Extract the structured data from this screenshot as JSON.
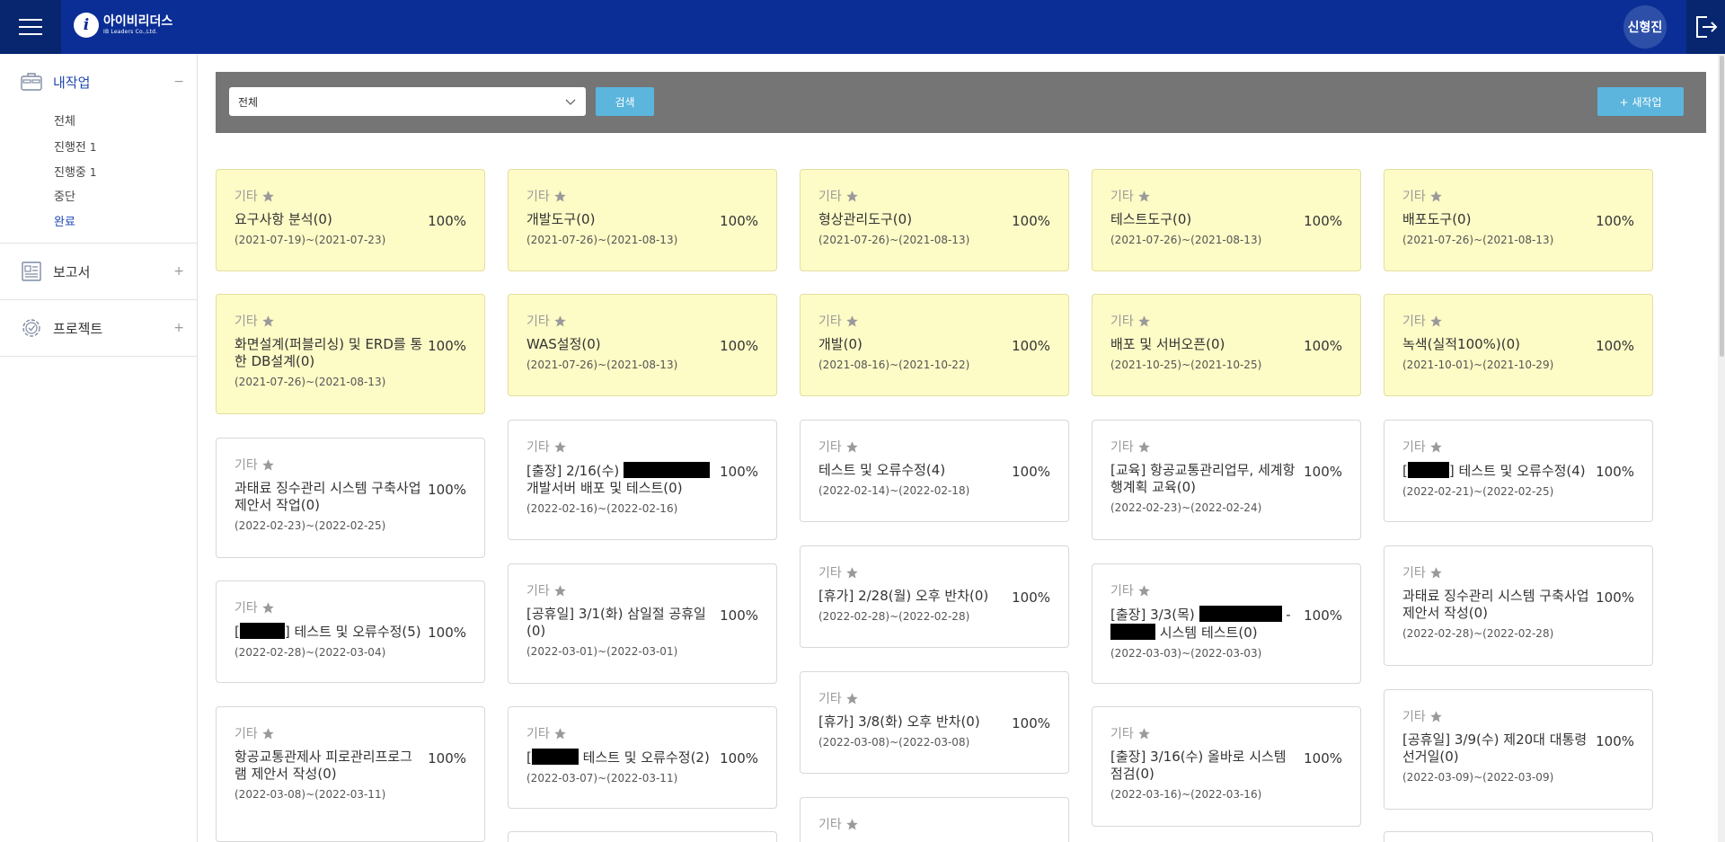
{
  "header": {
    "logo_kr": "아이비리더스",
    "logo_en": "IB Leaders Co.,Ltd.",
    "user_name": "신형진"
  },
  "sidebar": {
    "work_label": "내작업",
    "work_toggle": "−",
    "sub_items": [
      {
        "label": "전체",
        "count": ""
      },
      {
        "label": "진행전",
        "count": "1"
      },
      {
        "label": "진행중",
        "count": "1"
      },
      {
        "label": "중단",
        "count": ""
      },
      {
        "label": "완료",
        "count": ""
      }
    ],
    "report_label": "보고서",
    "report_toggle": "+",
    "project_label": "프로젝트",
    "project_toggle": "+"
  },
  "filter": {
    "select_value": "전체",
    "search_label": "검색",
    "new_label": "+ 새작업"
  },
  "cards": [
    {
      "category": "기타",
      "title": "요구사항 분석(0)",
      "percent": "100%",
      "dates": "(2021-07-19)~(2021-07-23)"
    },
    {
      "category": "기타",
      "title": "개발도구(0)",
      "percent": "100%",
      "dates": "(2021-07-26)~(2021-08-13)"
    },
    {
      "category": "기타",
      "title": "형상관리도구(0)",
      "percent": "100%",
      "dates": "(2021-07-26)~(2021-08-13)"
    },
    {
      "category": "기타",
      "title": "테스트도구(0)",
      "percent": "100%",
      "dates": "(2021-07-26)~(2021-08-13)"
    },
    {
      "category": "기타",
      "title": "배포도구(0)",
      "percent": "100%",
      "dates": "(2021-07-26)~(2021-08-13)"
    },
    {
      "category": "기타",
      "title": "화면설계(퍼블리싱) 및 ERD를 통한 DB설계(0)",
      "percent": "100%",
      "dates": "(2021-07-26)~(2021-08-13)"
    },
    {
      "category": "기타",
      "title": "WAS설정(0)",
      "percent": "100%",
      "dates": "(2021-07-26)~(2021-08-13)"
    },
    {
      "category": "기타",
      "title": "개발(0)",
      "percent": "100%",
      "dates": "(2021-08-16)~(2021-10-22)"
    },
    {
      "category": "기타",
      "title": "배포 및 서버오픈(0)",
      "percent": "100%",
      "dates": "(2021-10-25)~(2021-10-25)"
    },
    {
      "category": "기타",
      "title": "녹색(실적100%)(0)",
      "percent": "100%",
      "dates": "(2021-10-01)~(2021-10-29)"
    },
    {
      "category": "기타",
      "title": "과태료 징수관리 시스템 구축사업 제안서 작업(0)",
      "percent": "100%",
      "dates": "(2022-02-23)~(2022-02-25)"
    },
    {
      "category": "기타",
      "title_a": "[출장] 2/16(수)",
      "title_b": "개발서버 배포 및 테스트(0)",
      "percent": "100%",
      "dates": "(2022-02-16)~(2022-02-16)"
    },
    {
      "category": "기타",
      "title": "테스트 및 오류수정(4)",
      "percent": "100%",
      "dates": "(2022-02-14)~(2022-02-18)"
    },
    {
      "category": "기타",
      "title": "[교육] 항공교통관리업무, 세계항행계획 교육(0)",
      "percent": "100%",
      "dates": "(2022-02-23)~(2022-02-24)"
    },
    {
      "category": "기타",
      "title_a": "[",
      "title_b": "] 테스트 및 오류수정(4)",
      "percent": "100%",
      "dates": "(2022-02-21)~(2022-02-25)"
    },
    {
      "category": "기타",
      "title_a": "[",
      "title_b": "] 테스트 및 오류수정(5)",
      "percent": "100%",
      "dates": "(2022-02-28)~(2022-03-04)"
    },
    {
      "category": "기타",
      "title": "[공휴일] 3/1(화) 삼일절 공휴일(0)",
      "percent": "100%",
      "dates": "(2022-03-01)~(2022-03-01)"
    },
    {
      "category": "기타",
      "title": "[휴가] 2/28(월) 오후 반차(0)",
      "percent": "100%",
      "dates": "(2022-02-28)~(2022-02-28)"
    },
    {
      "category": "기타",
      "title_a": "[출장] 3/3(목)",
      "title_b": "-",
      "title_c": "시스템 테스트(0)",
      "percent": "100%",
      "dates": "(2022-03-03)~(2022-03-03)"
    },
    {
      "category": "기타",
      "title": "과태료 징수관리 시스템 구축사업 제안서 작성(0)",
      "percent": "100%",
      "dates": "(2022-02-28)~(2022-02-28)"
    },
    {
      "category": "기타",
      "title": "항공교통관제사 피로관리프로그램 제안서 작성(0)",
      "percent": "100%",
      "dates": "(2022-03-08)~(2022-03-11)"
    },
    {
      "category": "기타",
      "title_a": "[",
      "title_b": "테스트 및 오류수정(2)",
      "percent": "100%",
      "dates": "(2022-03-07)~(2022-03-11)"
    },
    {
      "category": "기타",
      "title": "[휴가] 3/8(화) 오후 반차(0)",
      "percent": "100%",
      "dates": "(2022-03-08)~(2022-03-08)"
    },
    {
      "category": "기타",
      "title": "[출장] 3/16(수) 올바로 시스템 점검(0)",
      "percent": "100%",
      "dates": "(2022-03-16)~(2022-03-16)"
    },
    {
      "category": "기타",
      "title": "[공휴일] 3/9(수) 제20대 대통령 선거일(0)",
      "percent": "100%",
      "dates": "(2022-03-09)~(2022-03-09)"
    },
    {
      "category": "기타"
    }
  ],
  "icons": {
    "menu": "hamburger-icon",
    "logout": "logout-icon",
    "star": "star-icon",
    "chevron": "chevron-down-icon"
  },
  "colors": {
    "header": "#0b2e96",
    "accent": "#5bb5dc",
    "card_done": "#fdfbc6",
    "sidebar_active": "#1f47b3"
  }
}
